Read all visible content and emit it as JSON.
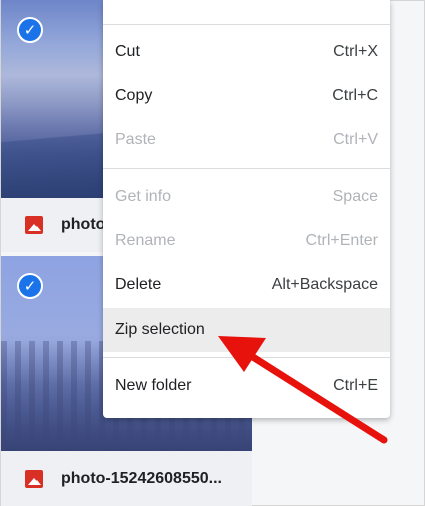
{
  "tiles": [
    {
      "filename": "photo"
    },
    {
      "filename": "photo-15242608550..."
    }
  ],
  "menu": {
    "items": [
      {
        "label": "Cut",
        "shortcut": "Ctrl+X"
      },
      {
        "label": "Copy",
        "shortcut": "Ctrl+C"
      },
      {
        "label": "Paste",
        "shortcut": "Ctrl+V"
      },
      {
        "label": "Get info",
        "shortcut": "Space"
      },
      {
        "label": "Rename",
        "shortcut": "Ctrl+Enter"
      },
      {
        "label": "Delete",
        "shortcut": "Alt+Backspace"
      },
      {
        "label": "Zip selection",
        "shortcut": ""
      },
      {
        "label": "New folder",
        "shortcut": "Ctrl+E"
      }
    ]
  },
  "colors": {
    "accent": "#1a73e8",
    "arrow": "#e8120c",
    "image_icon": "#d93025"
  },
  "icons": {
    "check": "check-icon",
    "image": "image-file-icon"
  }
}
